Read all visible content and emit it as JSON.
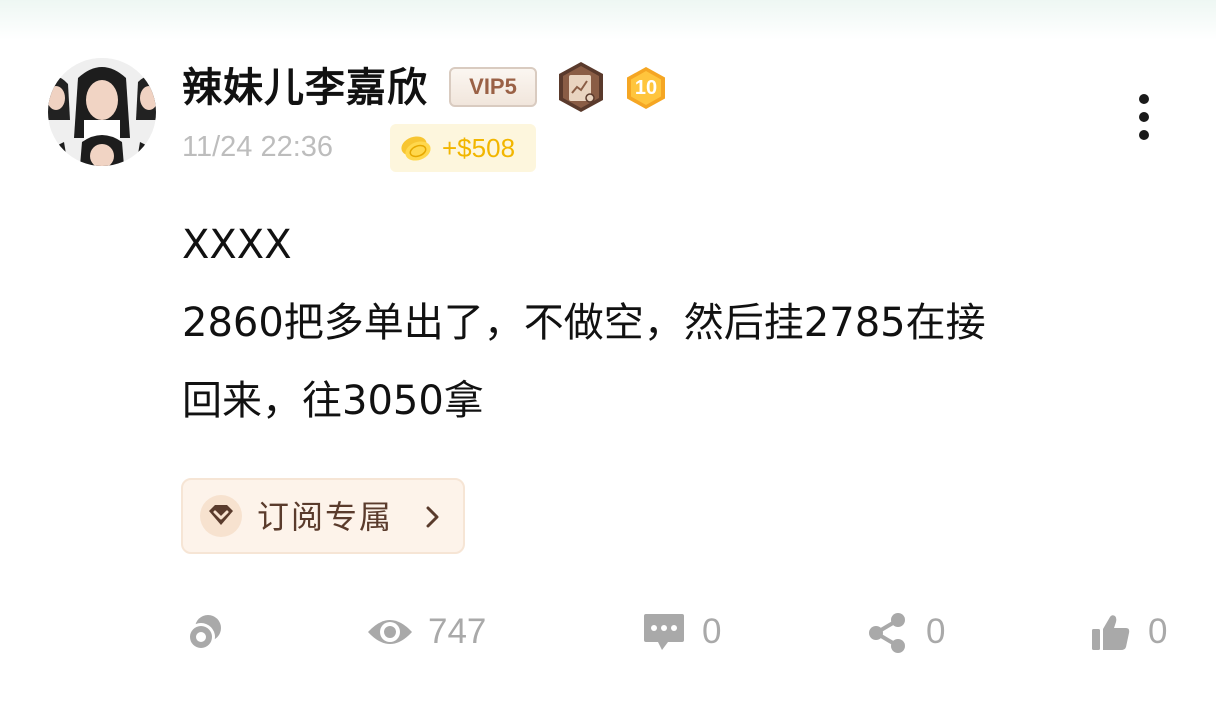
{
  "post": {
    "username": "辣妹儿李嘉欣",
    "vip_label": "VIP5",
    "level_badge": "10",
    "timestamp": "11/24 22:36",
    "reward": "+$508",
    "body_lines": [
      "XXXX",
      "2860把多单出了，不做空，然后挂2785在接",
      "回来，往3050拿"
    ],
    "subscribe_label": "订阅专属"
  },
  "actions": {
    "link": {
      "icon": "coin-link-icon"
    },
    "views": {
      "icon": "eye-icon",
      "count": "747"
    },
    "comments": {
      "icon": "comment-icon",
      "count": "0"
    },
    "shares": {
      "icon": "share-icon",
      "count": "0"
    },
    "likes": {
      "icon": "thumbs-up-icon",
      "count": "0"
    }
  },
  "colors": {
    "vip_text": "#9a6146",
    "reward_text": "#f2b600",
    "reward_bg": "#fdf6dd",
    "subscribe_bg": "#fdf3ea",
    "muted_gray": "#a9a9a9",
    "level_badge": "#f5a623"
  }
}
